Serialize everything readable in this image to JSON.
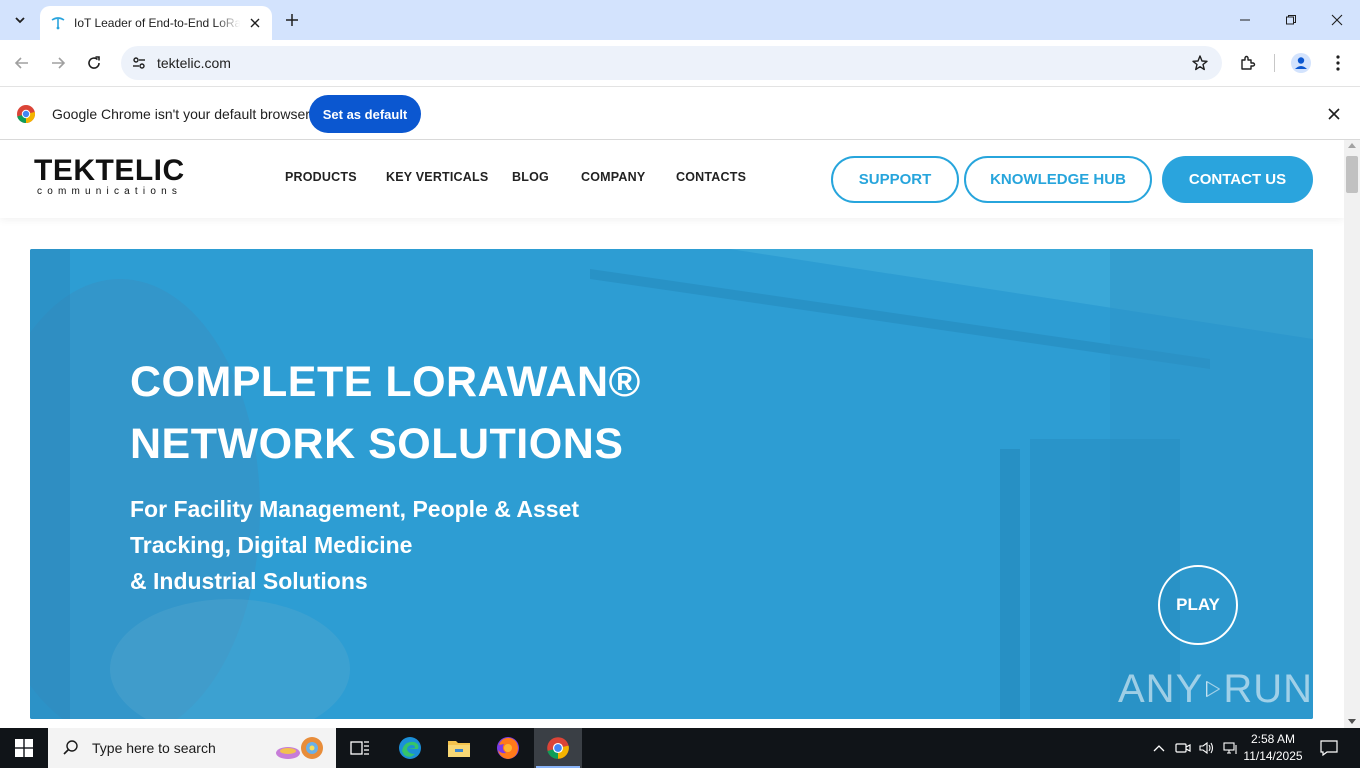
{
  "browser": {
    "tab_title": "IoT Leader of End-to-End LoRaWAN",
    "url": "tektelic.com",
    "infobar_text": "Google Chrome isn't your default browser",
    "infobar_button": "Set as default"
  },
  "site": {
    "logo_main": "TEKTELIC",
    "logo_sub": "communications",
    "nav": [
      "PRODUCTS",
      "KEY VERTICALS",
      "BLOG",
      "COMPANY",
      "CONTACTS"
    ],
    "support_button": "SUPPORT",
    "knowledge_button": "KNOWLEDGE HUB",
    "contact_button": "CONTACT US",
    "hero_title_1": "COMPLETE LORAWAN®",
    "hero_title_2": "NETWORK SOLUTIONS",
    "hero_sub_1": "For Facility Management, People & Asset",
    "hero_sub_2": "Tracking, Digital Medicine",
    "hero_sub_3": "& Industrial Solutions",
    "play_label": "PLAY",
    "watermark": "ANY RUN"
  },
  "colors": {
    "accent": "#2aa4dd",
    "chrome_blue": "#0b57d0",
    "tabstrip": "#d3e3fd"
  },
  "taskbar": {
    "search_placeholder": "Type here to search",
    "time": "2:58 AM",
    "date": "11/14/2025"
  }
}
